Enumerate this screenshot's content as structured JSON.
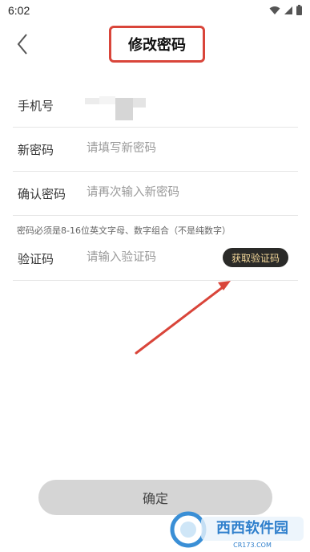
{
  "status_bar": {
    "time": "6:02",
    "icons": [
      "wifi-icon",
      "signal-icon",
      "battery-icon"
    ]
  },
  "header": {
    "back_icon": "back-chevron-icon",
    "title": "修改密码"
  },
  "form": {
    "phone": {
      "label": "手机号",
      "value": ""
    },
    "new_password": {
      "label": "新密码",
      "placeholder": "请填写新密码",
      "value": ""
    },
    "confirm_password": {
      "label": "确认密码",
      "placeholder": "请再次输入新密码",
      "value": ""
    },
    "hint": "密码必须是8-16位英文字母、数字组合（不是纯数字）",
    "verify_code": {
      "label": "验证码",
      "placeholder": "请输入验证码",
      "value": "",
      "button_label": "获取验证码"
    }
  },
  "confirm_button": {
    "label": "确定"
  },
  "watermark": {
    "text": "西西软件园",
    "subtext": "CR173.COM"
  },
  "colors": {
    "highlight": "#d9453a",
    "code_button_bg": "#2a2a28",
    "code_button_text": "#f4d89a",
    "confirm_bg": "#d5d5d5"
  }
}
